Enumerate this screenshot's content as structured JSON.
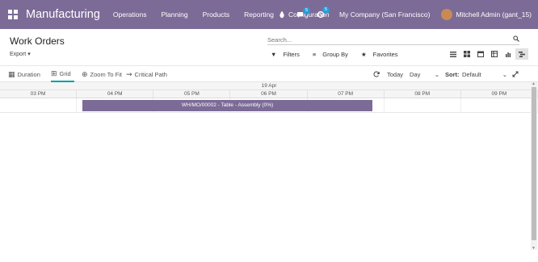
{
  "navbar": {
    "app_name": "Manufacturing",
    "menu": [
      "Operations",
      "Planning",
      "Products",
      "Reporting",
      "Configuration"
    ],
    "messages_count": "5",
    "activities_count": "5",
    "company": "My Company (San Francisco)",
    "user": "Mitchell Admin (gant_15)",
    "color": "#7c6b97"
  },
  "control_panel": {
    "title": "Work Orders",
    "export_label": "Export",
    "search_placeholder": "Search...",
    "filters_label": "Filters",
    "group_by_label": "Group By",
    "favorites_label": "Favorites",
    "views": [
      "list-icon",
      "kanban-icon",
      "calendar-icon",
      "pivot-icon",
      "graph-icon",
      "gantt-icon"
    ],
    "active_view": "gantt-icon"
  },
  "gantt_toolbar": {
    "tabs": [
      "Duration",
      "Grid",
      "Zoom To Fit",
      "Critical Path"
    ],
    "active_tab": "Grid",
    "today_label": "Today",
    "scale_value": "Day",
    "sort_label": "Sort:",
    "sort_value": "Default"
  },
  "gantt": {
    "date": "19 Apr",
    "hours": [
      "03 PM",
      "04 PM",
      "05 PM",
      "06 PM",
      "07 PM",
      "08 PM",
      "09 PM"
    ],
    "task": {
      "label": "WH/MO/00002 - Table - Assembly (0%)",
      "progress_percent": 0,
      "color": "#7c6b97"
    }
  }
}
